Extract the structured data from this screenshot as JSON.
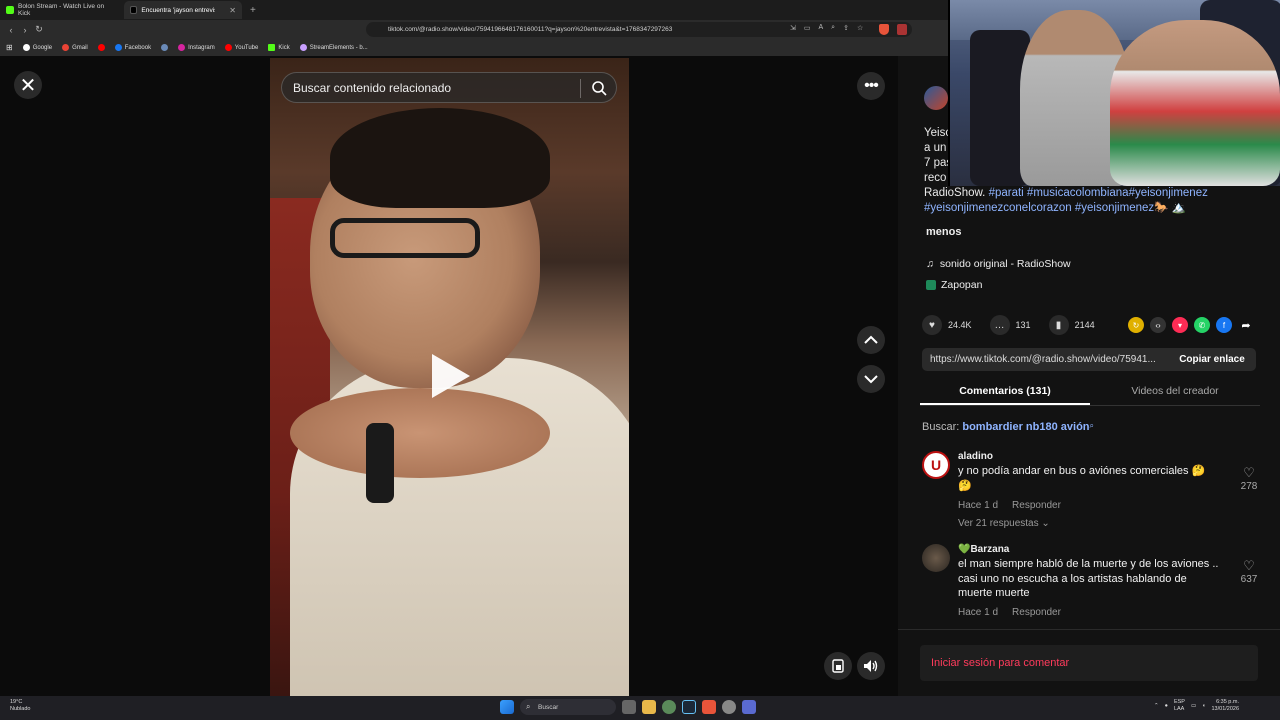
{
  "browser": {
    "tabs": [
      {
        "label": "Bolon Stream - Watch Live on Kick",
        "active": false
      },
      {
        "label": "Encuentra 'jayson entrevista' en",
        "active": true
      }
    ],
    "url": "tiktok.com/@radio.show/video/7594196648176160011?q=jayson%20entrevista&t=1768347297263",
    "bookmarks": [
      "Google",
      "Gmail",
      "Facebook",
      "Instagram",
      "YouTube",
      "Kick",
      "StreamElements - b..."
    ]
  },
  "viewer": {
    "search_placeholder": "Buscar contenido relacionado",
    "close_glyph": "✕",
    "more_glyph": "•••"
  },
  "panel": {
    "description_lines": [
      "Yeiso",
      "a un",
      "7 pas",
      "reco"
    ],
    "description_tail_text": "RadioShow.",
    "hashtags_line1": "#parati #musicacolombiana#yeisonjimenez",
    "hashtags_line2": "#yeisonjimenezconelcorazon #yeisonjimenez🐎 🏔️",
    "less_label": "menos",
    "sound": "sonido original - RadioShow",
    "location": "Zapopan",
    "likes": "24.4K",
    "comments_count": "131",
    "saves": "2144",
    "link_url": "https://www.tiktok.com/@radio.show/video/75941...",
    "copy_label": "Copiar enlace",
    "tab_comments": "Comentarios (131)",
    "tab_creator": "Videos del creador",
    "search_prefix": "Buscar:",
    "search_query": "bombardier nb180 avión",
    "login_label": "Iniciar sesión para comentar"
  },
  "comments": [
    {
      "user": "aladino",
      "text": "y no podía andar en bus o aviónes comerciales 🤔 🤔",
      "time": "Hace 1 d",
      "reply": "Responder",
      "replies": "Ver 21 respuestas",
      "likes": "278"
    },
    {
      "user": "💚Barzana",
      "text": "el man siempre habló de la muerte y de los aviones .. casi uno no escucha a los artistas hablando de muerte muerte",
      "time": "Hace 1 d",
      "reply": "Responder",
      "likes": "637"
    }
  ],
  "taskbar": {
    "weather_temp": "19°C",
    "weather_label": "Nublado",
    "search_label": "Buscar",
    "lang_line1": "ESP",
    "lang_line2": "LAA",
    "time": "6:35 p.m.",
    "date": "13/01/2026"
  },
  "colors": {
    "accent_link": "#8fb4ff",
    "login_red": "#ff3b5c"
  }
}
